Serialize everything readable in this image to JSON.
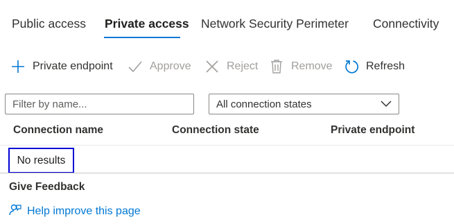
{
  "tabs": [
    {
      "label": "Public access",
      "active": false
    },
    {
      "label": "Private access",
      "active": true
    },
    {
      "label": "Network Security Perimeter",
      "active": false
    },
    {
      "label": "Connectivity",
      "active": false
    }
  ],
  "toolbar": {
    "add_label": "Private endpoint",
    "approve_label": "Approve",
    "reject_label": "Reject",
    "remove_label": "Remove",
    "refresh_label": "Refresh"
  },
  "filter": {
    "placeholder": "Filter by name...",
    "state_value": "All connection states"
  },
  "table": {
    "headers": [
      "Connection name",
      "Connection state",
      "Private endpoint"
    ],
    "empty_text": "No results"
  },
  "feedback": {
    "title": "Give Feedback",
    "link_label": "Help improve this page"
  },
  "colors": {
    "accent": "#0078d4",
    "disabled": "#a19f9d",
    "highlight_box": "#0000d6"
  }
}
